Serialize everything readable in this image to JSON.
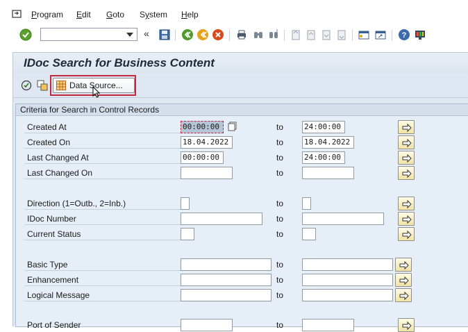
{
  "menu": {
    "items": [
      {
        "pre": "",
        "ul": "P",
        "post": "rogram"
      },
      {
        "pre": "",
        "ul": "E",
        "post": "dit"
      },
      {
        "pre": "",
        "ul": "G",
        "post": "oto"
      },
      {
        "pre": "S",
        "ul": "y",
        "post": "stem"
      },
      {
        "pre": "",
        "ul": "H",
        "post": "elp"
      }
    ]
  },
  "toolbar": {
    "command_field_value": "",
    "icons": [
      "enter-check-icon",
      "nav-back-icon",
      "save-icon",
      "back-green-icon",
      "exit-yellow-icon",
      "cancel-red-icon",
      "print-icon",
      "find-icon",
      "find-next-icon",
      "first-page-icon",
      "prev-page-icon",
      "next-page-icon",
      "last-page-icon",
      "new-session-icon",
      "create-shortcut-icon",
      "help-icon",
      "customize-layout-icon"
    ]
  },
  "page": {
    "title": "IDoc Search for Business Content"
  },
  "app_toolbar": {
    "data_source_label": "Data Source..."
  },
  "criteria": {
    "group_title": "Criteria for Search in Control Records",
    "to_label": "to",
    "rows": [
      {
        "label": "Created At",
        "from": "00:00:00",
        "to": "24:00:00"
      },
      {
        "label": "Created On",
        "from": "18.04.2022",
        "to": "18.04.2022"
      },
      {
        "label": "Last Changed At",
        "from": "00:00:00",
        "to": "24:00:00"
      },
      {
        "label": "Last Changed On",
        "from": "",
        "to": ""
      },
      {
        "label": "Direction (1=Outb., 2=Inb.)",
        "from": "",
        "to": ""
      },
      {
        "label": "IDoc Number",
        "from": "",
        "to": ""
      },
      {
        "label": "Current Status",
        "from": "",
        "to": ""
      },
      {
        "label": "Basic Type",
        "from": "",
        "to": ""
      },
      {
        "label": "Enhancement",
        "from": "",
        "to": ""
      },
      {
        "label": "Logical Message",
        "from": "",
        "to": ""
      },
      {
        "label": "Port of Sender",
        "from": "",
        "to": ""
      }
    ]
  }
}
